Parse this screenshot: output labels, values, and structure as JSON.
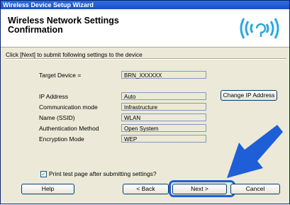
{
  "window": {
    "title": "Wireless Device Setup Wizard"
  },
  "header": {
    "title": "Wireless Network Settings Confirmation",
    "logo": "wifi-signal-logo"
  },
  "instruction": "Click [Next] to submit following settings to the device",
  "target": {
    "label": "Target Device =",
    "value": "BRN_XXXXXX"
  },
  "fields": [
    {
      "label": "IP Address",
      "value": "Auto"
    },
    {
      "label": "Communication mode",
      "value": "Infrastructure"
    },
    {
      "label": "Name (SSID)",
      "value": "WLAN"
    },
    {
      "label": "Authentication Method",
      "value": "Open System"
    },
    {
      "label": "Encryption Mode",
      "value": "WEP"
    }
  ],
  "change_ip_label": "Change IP Address",
  "print_test": {
    "checked": true,
    "label": "Print test page after submitting settings?"
  },
  "buttons": {
    "help": "Help",
    "back": "< Back",
    "next": "Next >",
    "cancel": "Cancel"
  },
  "colors": {
    "accent": "#1e5fd8",
    "title_bar": "#1a4fc4"
  }
}
